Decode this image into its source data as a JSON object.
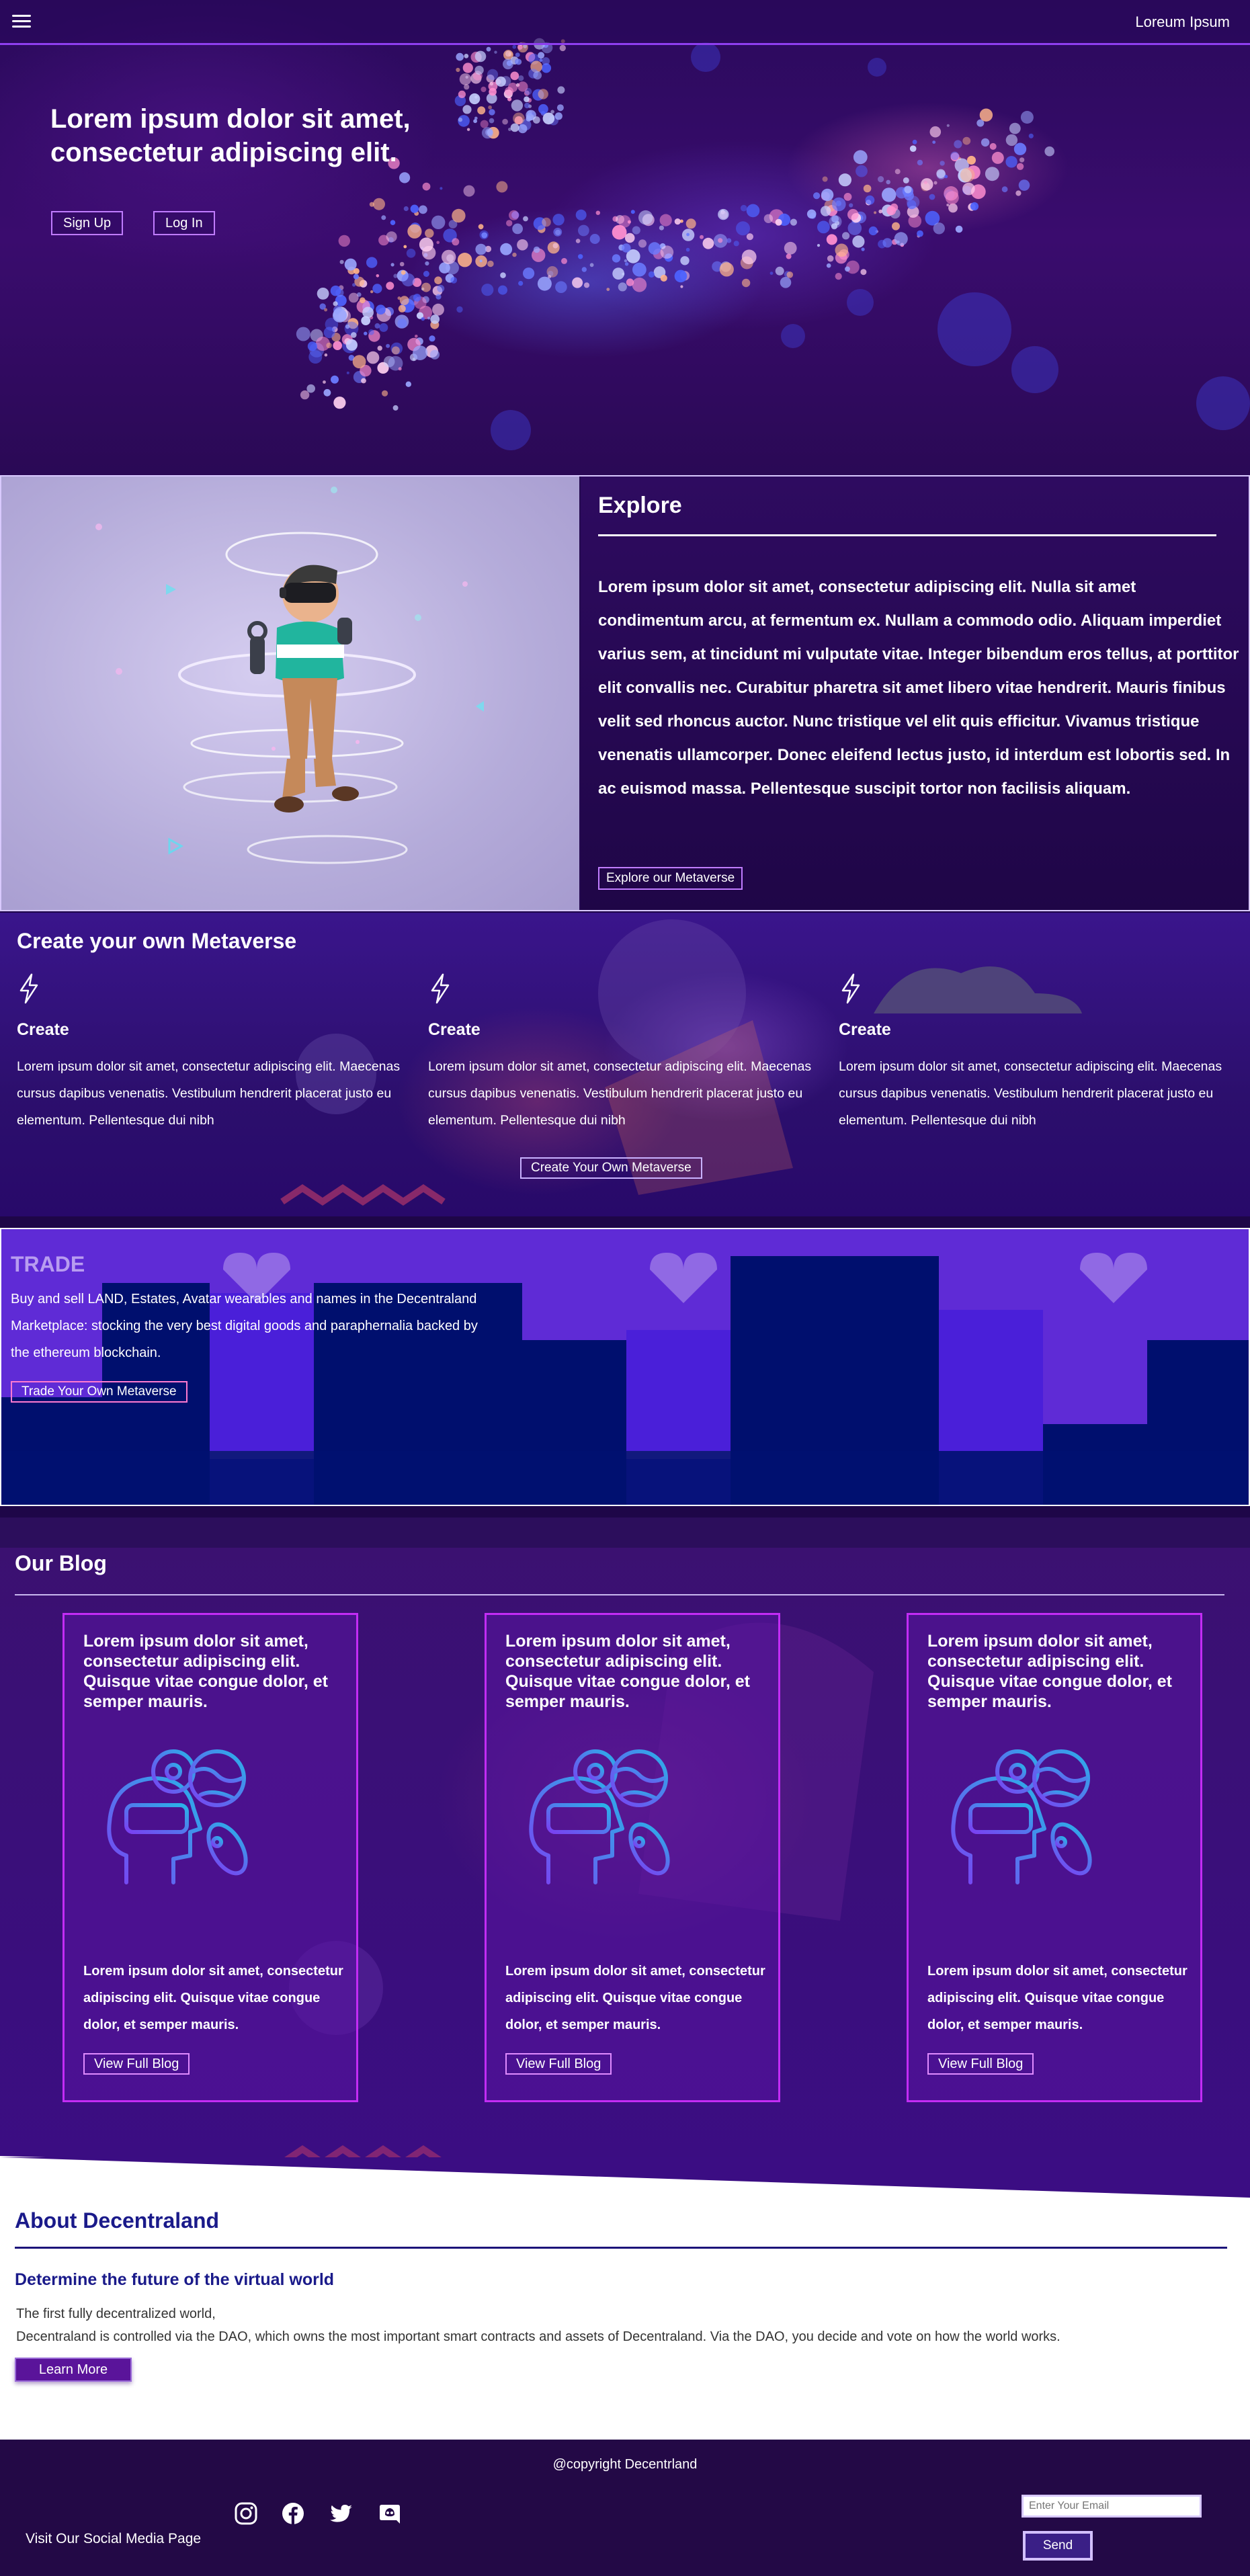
{
  "header": {
    "brand": "Loreum Ipsum",
    "hero_title": "Lorem ipsum dolor sit amet, consectetur adipiscing elit.",
    "signup_label": "Sign Up",
    "login_label": "Log In"
  },
  "explore": {
    "title": "Explore",
    "body": "Lorem ipsum dolor sit amet, consectetur adipiscing elit. Nulla sit amet condimentum arcu, at fermentum ex. Nullam a commodo odio. Aliquam imperdiet varius sem, at tincidunt mi vulputate vitae. Integer bibendum eros tellus, at porttitor elit convallis nec. Curabitur pharetra sit amet libero vitae hendrerit. Mauris finibus velit sed rhoncus auctor. Nunc tristique vel elit quis efficitur. Vivamus tristique venenatis ullamcorper. Donec eleifend lectus justo, id interdum est lobortis sed. In ac euismod massa. Pellentesque suscipit tortor non facilisis aliquam.",
    "button_label": "Explore our Metaverse"
  },
  "create": {
    "title": "Create your own Metaverse",
    "features": [
      {
        "title": "Create",
        "text": "Lorem ipsum dolor sit amet, consectetur adipiscing elit. Maecenas cursus dapibus venenatis. Vestibulum hendrerit placerat justo eu elementum. Pellentesque dui nibh"
      },
      {
        "title": "Create",
        "text": "Lorem ipsum dolor sit amet, consectetur adipiscing elit. Maecenas cursus dapibus venenatis. Vestibulum hendrerit placerat justo eu elementum. Pellentesque dui nibh"
      },
      {
        "title": "Create",
        "text": "Lorem ipsum dolor sit amet, consectetur adipiscing elit. Maecenas cursus dapibus venenatis. Vestibulum hendrerit placerat justo eu elementum. Pellentesque dui nibh"
      }
    ],
    "button_label": "Create Your Own Metaverse"
  },
  "trade": {
    "title": "TRADE",
    "body": "Buy and sell LAND, Estates, Avatar wearables and names in the Decentraland Marketplace: stocking the very best digital goods and paraphernalia backed by the ethereum blockchain.",
    "button_label": "Trade Your Own Metaverse"
  },
  "blog": {
    "title": "Our Blog",
    "cards": [
      {
        "heading": "Lorem ipsum dolor sit amet, consectetur adipiscing elit. Quisque vitae congue dolor, et semper mauris.",
        "body": "Lorem ipsum dolor sit amet, consectetur adipiscing elit. Quisque vitae congue dolor, et semper mauris.",
        "button_label": "View Full Blog"
      },
      {
        "heading": "Lorem ipsum dolor sit amet, consectetur adipiscing elit. Quisque vitae congue dolor, et semper mauris.",
        "body": "Lorem ipsum dolor sit amet, consectetur adipiscing elit. Quisque vitae congue dolor, et semper mauris.",
        "button_label": "View Full Blog"
      },
      {
        "heading": "Lorem ipsum dolor sit amet, consectetur adipiscing elit. Quisque vitae congue dolor, et semper mauris.",
        "body": "Lorem ipsum dolor sit amet, consectetur adipiscing elit. Quisque vitae congue dolor, et semper mauris.",
        "button_label": "View Full Blog"
      }
    ]
  },
  "about": {
    "title": "About Decentraland",
    "subtitle": "Determine the future of the virtual world",
    "line1": "The first fully decentralized world,",
    "line2": "Decentraland is controlled via the DAO, which owns the most important smart contracts and assets of Decentraland. Via the DAO, you decide and vote on how the world works.",
    "button_label": "Learn More"
  },
  "footer": {
    "copyright": "@copyright Decentrland",
    "social_label": "Visit Our Social Media Page",
    "social_icons": [
      "instagram-icon",
      "facebook-icon",
      "twitter-icon",
      "discord-icon"
    ],
    "email_placeholder": "Enter Your Email",
    "send_label": "Send"
  },
  "colors": {
    "accent": "#8f3ff0",
    "card_border": "#c32cf5",
    "about_title": "#1a1a8a",
    "footer_bg": "#230946"
  }
}
